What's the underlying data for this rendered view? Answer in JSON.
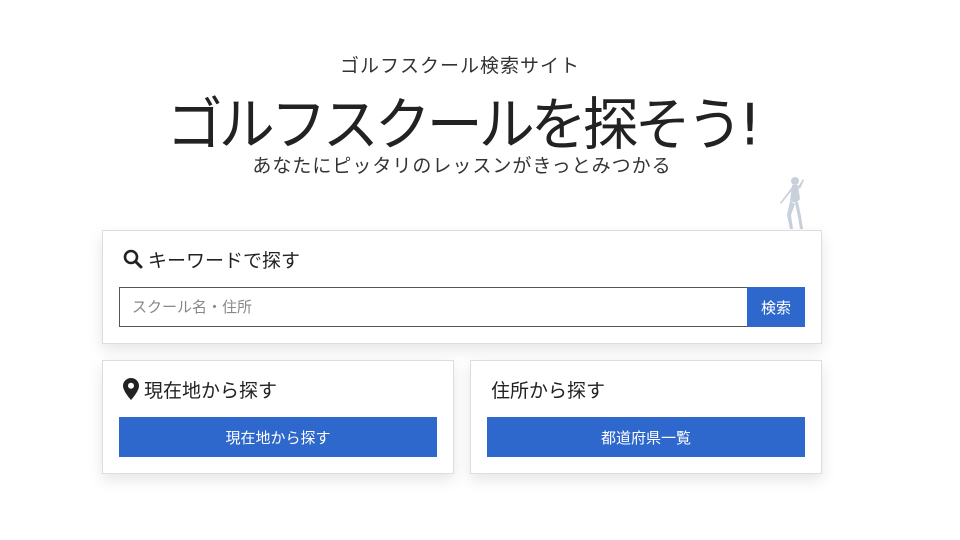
{
  "hero": {
    "subtitle": "ゴルフスクール検索サイト",
    "title": "ゴルフスクールを探そう!",
    "tagline": "あなたにピッタリのレッスンがきっとみつかる"
  },
  "keyword_search": {
    "heading": "キーワードで探す",
    "placeholder": "スクール名・住所",
    "value": "",
    "button_label": "検索",
    "icon": "search-icon"
  },
  "location_search": {
    "heading": "現在地から探す",
    "button_label": "現在地から探す",
    "icon": "map-pin-icon"
  },
  "address_search": {
    "heading": "住所から探す",
    "button_label": "都道府県一覧"
  },
  "colors": {
    "accent": "#2f68cc",
    "text": "#222222",
    "card_border": "#dddddd",
    "golfer_silhouette": "#c8d0dc"
  }
}
